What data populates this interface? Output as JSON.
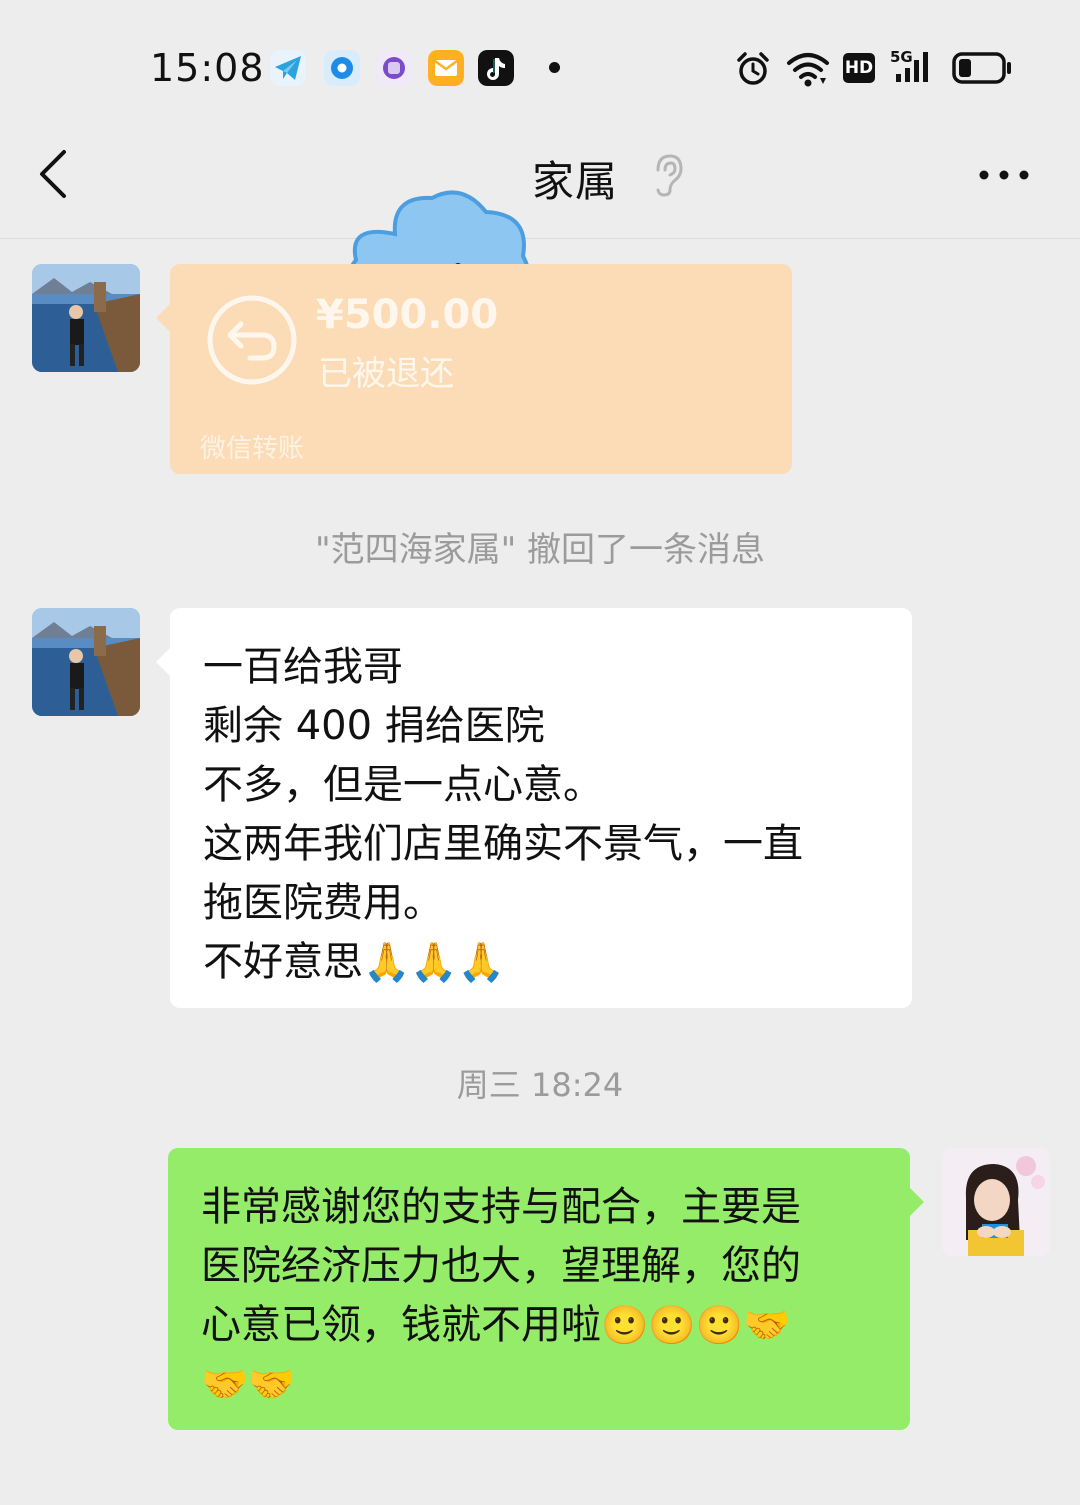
{
  "status_bar": {
    "time": "15:08",
    "network_label": "5G",
    "hd_label": "HD",
    "app_icons": [
      "telegram-icon",
      "browser-icon",
      "camera-app-icon",
      "mail-app-icon",
      "tiktok-icon"
    ],
    "system_icons": [
      "alarm-icon",
      "wifi-icon",
      "hd-icon",
      "cellular-signal-icon",
      "battery-icon"
    ],
    "battery_level": 0.3
  },
  "header": {
    "title": "家属",
    "back_icon": "chevron-left-icon",
    "mute_icon": "ear-icon",
    "more_icon": "more-dots-icon"
  },
  "messages": {
    "transfer": {
      "amount": "¥500.00",
      "status": "已被退还",
      "source": "微信转账"
    },
    "recall_notice": "\"范四海家属\" 撤回了一条消息",
    "incoming_text": {
      "lines": [
        "一百给我哥",
        "剩余 400 捐给医院",
        "不多，但是一点心意。",
        "这两年我们店里确实不景气，一直",
        "拖医院费用。",
        "不好意思"
      ],
      "trailing_emoji": "🙏🙏🙏"
    },
    "timestamp": "周三 18:24",
    "outgoing_text": {
      "lines": [
        "非常感谢您的支持与配合，主要是",
        "医院经济压力也大，望理解，您的",
        "心意已领，钱就不用啦"
      ],
      "line3_emoji": "🙂🙂🙂🤝",
      "line4_emoji": "🤝🤝"
    }
  },
  "colors": {
    "background": "#ededed",
    "incoming_bubble": "#ffffff",
    "outgoing_bubble": "#95ec69",
    "transfer_card": "#fbdcb7",
    "notice_text": "#9b9b9b"
  }
}
